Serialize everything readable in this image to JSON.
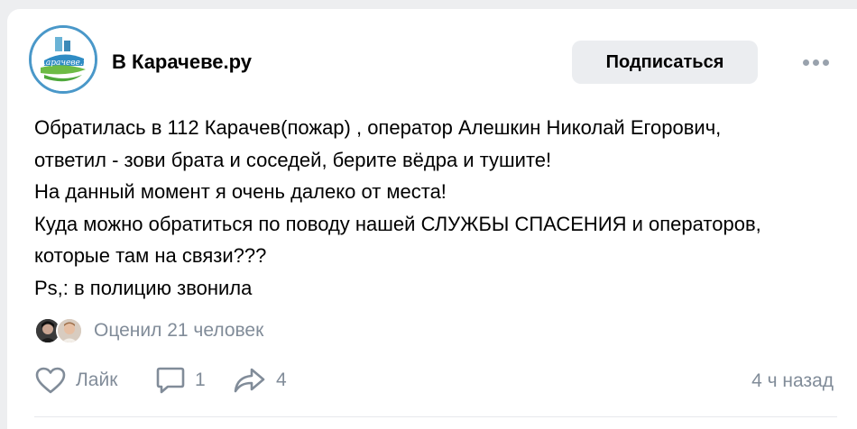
{
  "group": {
    "name": "В Карачеве.ру",
    "logo_text": "ВКарачеве.ру",
    "subscribe_label": "Подписаться"
  },
  "post": {
    "lines": [
      "Обратилась в 112 Карачев(пожар) , оператор Алешкин Николай Егорович,",
      "ответил - зови брата и соседей, берите вёдра и тушите!",
      "На данный момент я очень далеко от места!",
      "Куда можно обратиться по поводу нашей СЛУЖБЫ СПАСЕНИЯ и операторов,",
      "которые там на связи???",
      "Ps,: в полицию звонила"
    ]
  },
  "reactions": {
    "summary": "Оценил 21 человек"
  },
  "actions": {
    "like_label": "Лайк",
    "comments_count": "1",
    "shares_count": "4",
    "time": "4 ч назад"
  },
  "colors": {
    "secondary_text": "#818c99",
    "button_bg": "#ebedf0",
    "logo_border": "#4a98c9"
  }
}
